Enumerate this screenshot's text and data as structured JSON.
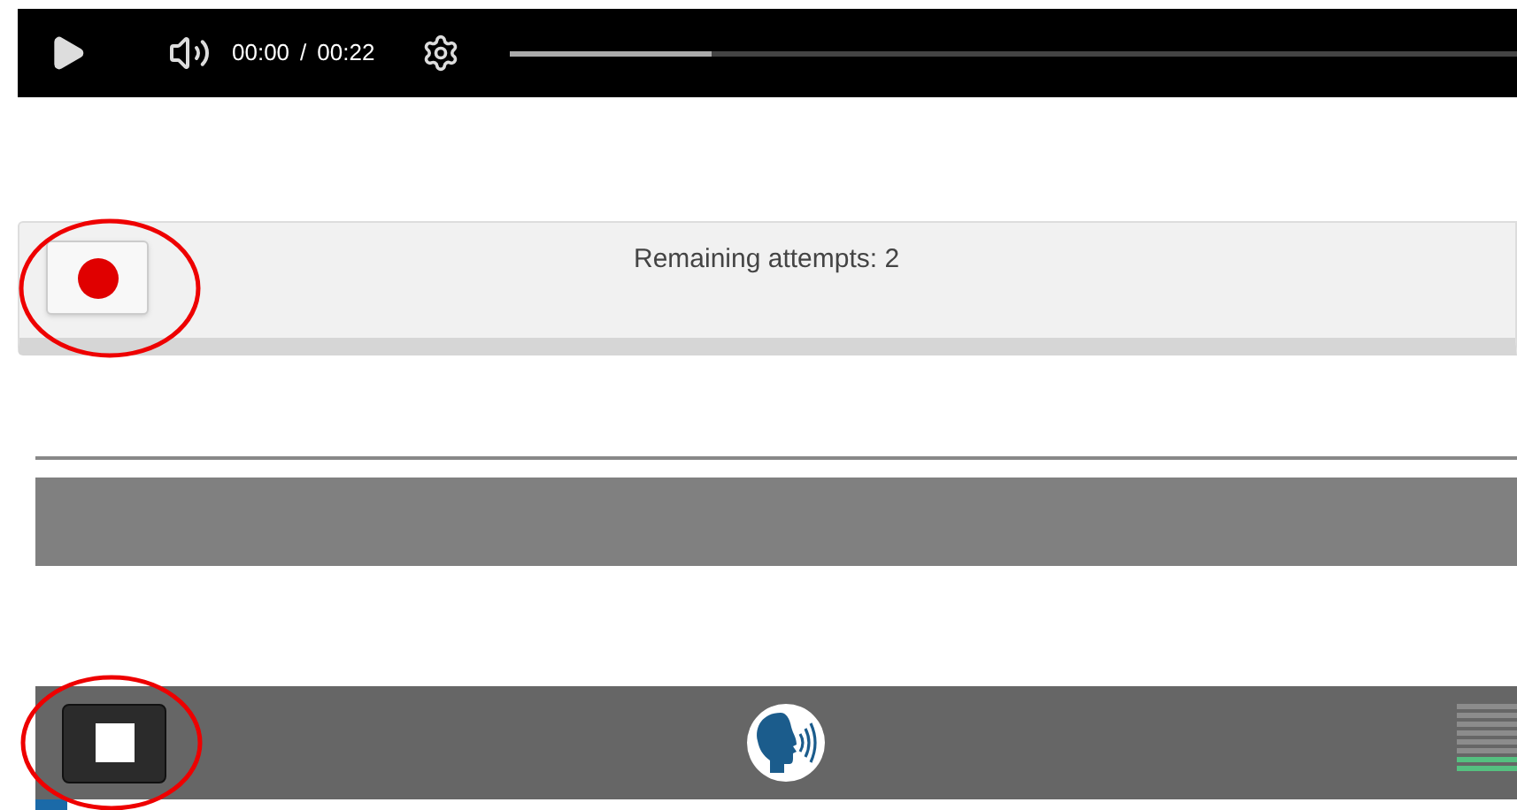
{
  "player": {
    "current_time": "00:00",
    "separator": "/",
    "duration": "00:22",
    "progress": {
      "level": 0.2
    }
  },
  "recorder": {
    "remaining_attempts": "Remaining attempts: 2",
    "recording": false
  },
  "recording_bar": {
    "recording": true,
    "meter": {
      "level": 0.25
    }
  }
}
